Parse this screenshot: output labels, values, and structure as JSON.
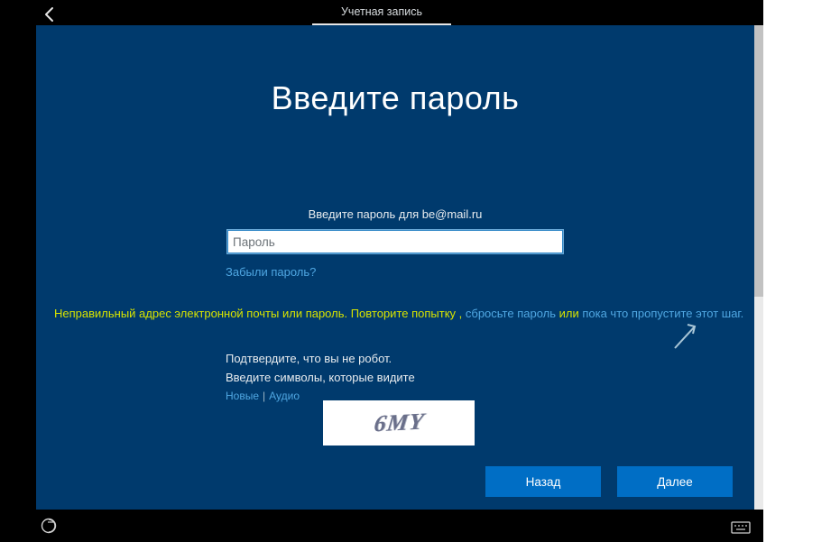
{
  "header": {
    "tab_label": "Учетная запись"
  },
  "main": {
    "title": "Введите пароль",
    "instruction": "Введите пароль для be@mail.ru",
    "password_placeholder": "Пароль",
    "password_value": "",
    "forgot_link": "Забыли пароль?"
  },
  "error": {
    "part1": "Неправильный адрес электронной почты или пароль. Повторите попытку",
    "sep1": " , ",
    "reset_link": "сбросьте пароль",
    "sep2": " или ",
    "skip_link": "пока что пропустите этот шаг."
  },
  "captcha": {
    "confirm_label": "Подтвердите, что вы не робот.",
    "enter_label": "Введите символы, которые видите",
    "new_link": "Новые",
    "audio_link": "Аудио",
    "image_text": "6MY"
  },
  "footer": {
    "back_label": "Назад",
    "next_label": "Далее"
  }
}
